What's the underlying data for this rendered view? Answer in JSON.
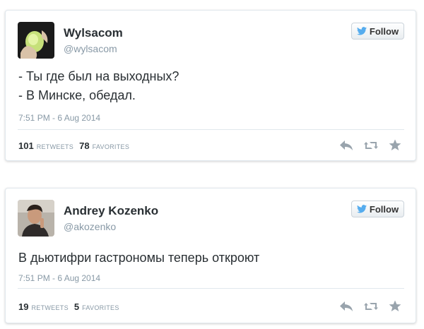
{
  "colors": {
    "twitter_blue": "#55acee",
    "icon_gray": "#99a4ad"
  },
  "follow_label": "Follow",
  "tweets": [
    {
      "name": "Wylsacom",
      "handle": "@wylsacom",
      "lines": [
        "- Ты где был на выходных?",
        "- В Минске, обедал."
      ],
      "timestamp": "7:51 PM - 6 Aug 2014",
      "retweets": "101",
      "retweets_label": "RETWEETS",
      "favorites": "78",
      "favorites_label": "FAVORITES",
      "avatar_icon": "hand-with-green-object-avatar"
    },
    {
      "name": "Andrey Kozenko",
      "handle": "@akozenko",
      "lines": [
        "В дьютифри гастрономы теперь откроют"
      ],
      "timestamp": "7:51 PM - 6 Aug 2014",
      "retweets": "19",
      "retweets_label": "RETWEETS",
      "favorites": "5",
      "favorites_label": "FAVORITES",
      "avatar_icon": "man-portrait-avatar"
    }
  ]
}
